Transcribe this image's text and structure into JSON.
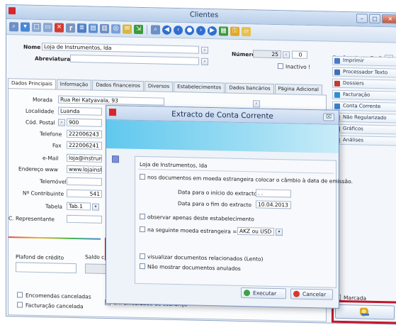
{
  "window": {
    "title": "Clientes"
  },
  "header": {
    "nome_label": "Nome",
    "nome_value": "Loja de Instrumentos, lda",
    "abreviatura_label": "Abreviatura",
    "numero_label": "Número",
    "numero_value": "25",
    "numero_sub": "0",
    "inactivo_label": "Inactivo !",
    "opcoes_label": "Opções deste Ecrã"
  },
  "tabs": [
    {
      "label": "Dados Principais"
    },
    {
      "label": "Informação"
    },
    {
      "label": "Dados financeiros"
    },
    {
      "label": "Diversos"
    },
    {
      "label": "Estabelecimentos"
    },
    {
      "label": "Dados bancários"
    },
    {
      "label": "Página Adicional"
    }
  ],
  "form": {
    "morada_label": "Morada",
    "morada_value": "Rua Rei Katyavala, 93",
    "localidade_label": "Localidade",
    "localidade_value": "Luanda",
    "codpostal_label": "Cód. Postal",
    "codpostal_value": "900",
    "telefone_label": "Telefone",
    "telefone_value": "222006243",
    "fax_label": "Fax",
    "fax_value": "222006241",
    "email_label": "e-Mail",
    "email_value": "loja@instrum",
    "endereco_label": "Endereço www",
    "endereco_value": "www.lojainst",
    "telemovel_label": "Telemóvel",
    "contribuinte_label": "Nº Contribuinte",
    "contribuinte_value": "541",
    "tabela_label": "Tabela",
    "tabela_value": "Tab.1",
    "representante_label": "C. Representante",
    "plafond_label": "Plafond de crédito",
    "saldo_label": "Saldo c",
    "encomendas_label": "Encomendas canceladas",
    "facturacao_label": "Facturação cancelada",
    "dificuldade_label": "em dificuldade de cobrança"
  },
  "right_panel": {
    "items": [
      {
        "label": "Imprimir",
        "color": "#4a78c4"
      },
      {
        "label": "Processador Texto",
        "color": "#3f6fb8"
      },
      {
        "label": "Dossiers",
        "color": "#c23b32"
      },
      {
        "label": "Facturação",
        "color": "#2b8fd1"
      },
      {
        "label": "Conta Corrente",
        "color": "#3b7ec9"
      },
      {
        "label": "Não Regularizado",
        "color": "#d2aa2a"
      },
      {
        "label": "Gráficos",
        "color": "#3c9a3c"
      },
      {
        "label": "Análises",
        "color": "#d88b24"
      }
    ],
    "marcada_label": "Marcada"
  },
  "dialog": {
    "title": "Extracto de Conta Corrente",
    "client_name": "Loja de Instrumentos, lda",
    "opt_moeda_cambio": "nos documentos em moeda estrangeira colocar o câmbio à data de emissão.",
    "data_inicio_label": "Data para o início do extracto",
    "data_inicio_value": " .  .",
    "data_fim_label": "Data para o fim do extracto",
    "data_fim_value": "10.04.2013",
    "opt_estabelecimento": "observar apenas deste estabelecimento",
    "opt_moeda_label": "na seguinte moeda estrangeira =>",
    "opt_moeda_value": "AKZ ou USD",
    "opt_relacionados": "visualizar documentos relacionados (Lento)",
    "opt_anulados": "Não mostrar documentos anulados",
    "executar_label": "Executar",
    "cancelar_label": "Cancelar",
    "close_label": "⌧"
  },
  "colors": {
    "highlight": "#c2152a",
    "banner": "#60c8ee"
  }
}
